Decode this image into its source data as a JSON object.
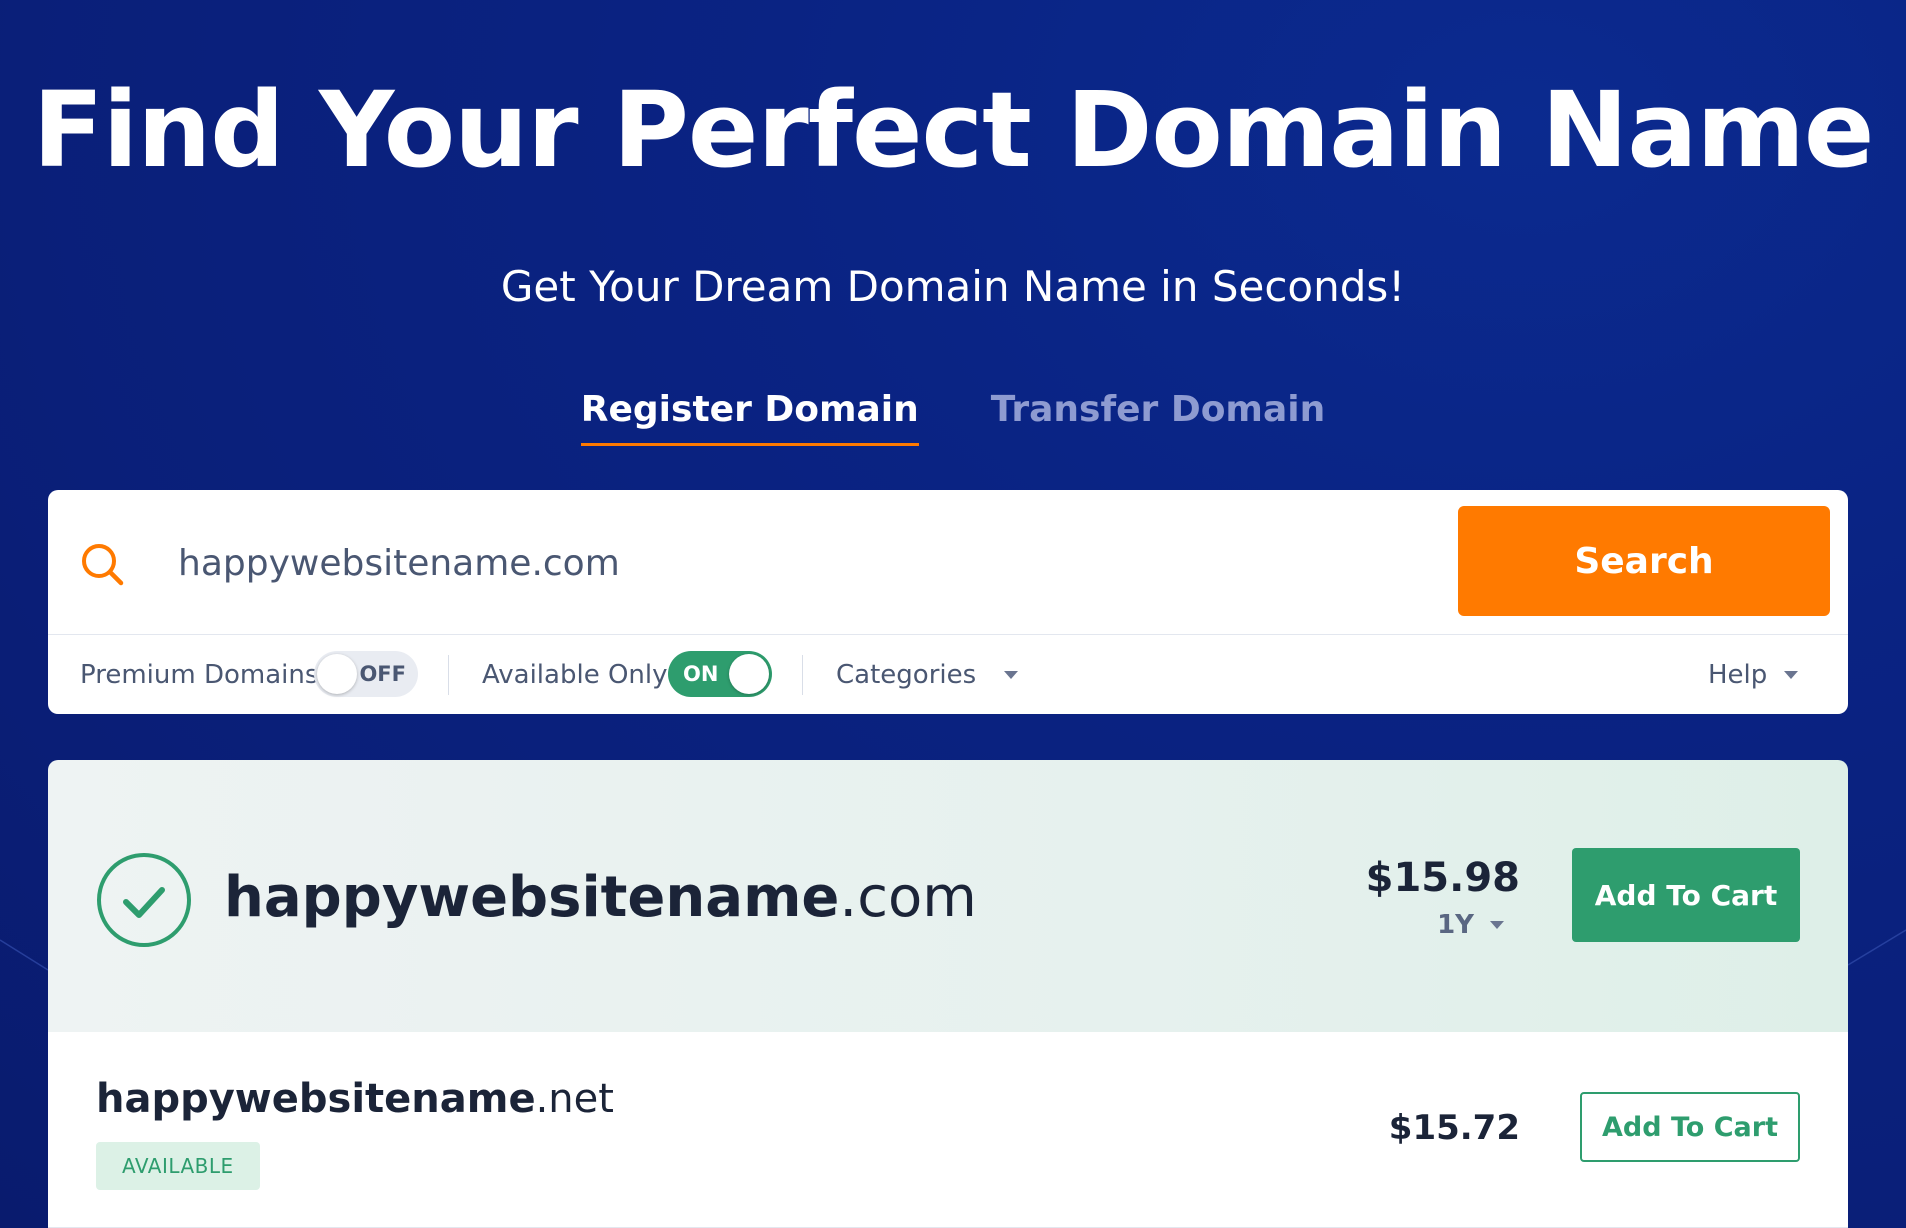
{
  "hero": {
    "title": "Find Your Perfect Domain Name",
    "subtitle": "Get Your Dream Domain Name in Seconds!"
  },
  "tabs": [
    {
      "label": "Register Domain",
      "active": true
    },
    {
      "label": "Transfer Domain",
      "active": false
    }
  ],
  "search": {
    "value": "happywebsitename.com",
    "button_label": "Search",
    "icon": "search-icon"
  },
  "filters": {
    "premium_label": "Premium Domains",
    "premium_state": "OFF",
    "available_label": "Available Only",
    "available_state": "ON",
    "categories_label": "Categories",
    "help_label": "Help"
  },
  "results": {
    "featured": {
      "sld": "happywebsitename",
      "tld": ".com",
      "price": "$15.98",
      "term": "1Y",
      "button_label": "Add To Cart",
      "status_icon": "check-circle-icon"
    },
    "items": [
      {
        "sld": "happywebsitename",
        "tld": ".net",
        "badge": "AVAILABLE",
        "price": "$15.72",
        "button_label": "Add To Cart"
      }
    ]
  },
  "colors": {
    "background": "#0a2383",
    "accent_orange": "#ff7a00",
    "success_green": "#2e9d6e",
    "text_dark": "#1b2438"
  }
}
